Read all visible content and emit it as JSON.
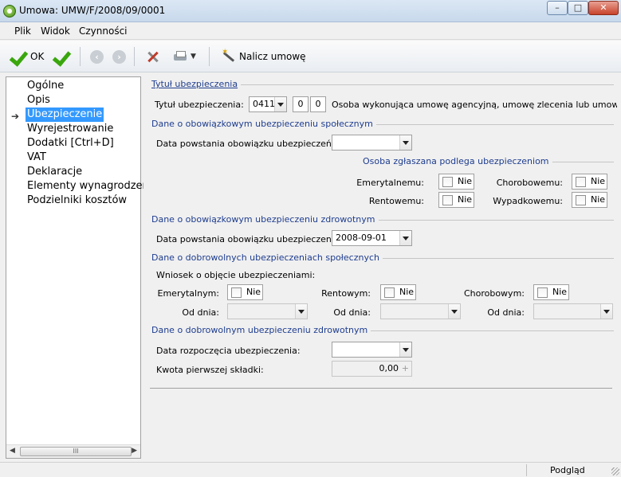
{
  "window": {
    "title": "Umowa: UMW/F/2008/09/0001"
  },
  "menu": {
    "items": [
      "Plik",
      "Widok",
      "Czynności"
    ]
  },
  "toolbar": {
    "ok_label": "OK",
    "calc_label": "Nalicz umowę"
  },
  "nav": {
    "items": [
      "Ogólne",
      "Opis",
      "Ubezpieczenie",
      "Wyrejestrowanie",
      "Dodatki [Ctrl+D]",
      "VAT",
      "Deklaracje",
      "Elementy wynagrodzeni",
      "Podzielniki kosztów"
    ],
    "selected_index": 2,
    "scroll_thumb": "III"
  },
  "sections": {
    "title_ins": {
      "heading": "Tytuł ubezpieczenia",
      "label": "Tytuł ubezpieczenia:",
      "code": "0411",
      "num1": "0",
      "num2": "0",
      "description": "Osoba wykonująca umowę agencyjną, umowę zlecenia lub umowę o św"
    },
    "social_mandatory": {
      "heading": "Dane o obowiązkowym ubezpieczeniu społecznym",
      "date_label": "Data powstania obowiązku ubezpieczeń:",
      "date_value": "",
      "subheading": "Osoba zgłaszana podlega ubezpieczeniom",
      "emerytalne_label": "Emerytalnemu:",
      "emerytalne_value": "Nie",
      "chorobowe_label": "Chorobowemu:",
      "chorobowe_value": "Nie",
      "rentowe_label": "Rentowemu:",
      "rentowe_value": "Nie",
      "wypadkowe_label": "Wypadkowemu:",
      "wypadkowe_value": "Nie"
    },
    "health_mandatory": {
      "heading": "Dane o obowiązkowym ubezpieczeniu zdrowotnym",
      "date_label": "Data powstania obowiązku ubezpieczenia:",
      "date_value": "2008-09-01"
    },
    "social_voluntary": {
      "heading": "Dane o dobrowolnych ubezpieczeniach społecznych",
      "request_label": "Wniosek o objęcie ubezpieczeniami:",
      "emerytalnym_label": "Emerytalnym:",
      "emerytalnym_value": "Nie",
      "rentowym_label": "Rentowym:",
      "rentowym_value": "Nie",
      "chorobowym_label": "Chorobowym:",
      "chorobowym_value": "Nie",
      "from_label": "Od dnia:"
    },
    "health_voluntary": {
      "heading": "Dane o dobrowolnym ubezpieczeniu zdrowotnym",
      "start_label": "Data rozpoczęcia ubezpieczenia:",
      "start_value": "",
      "fee_label": "Kwota pierwszej składki:",
      "fee_value": "0,00",
      "fee_plus": "+"
    }
  },
  "statusbar": {
    "text": "Podgląd"
  }
}
